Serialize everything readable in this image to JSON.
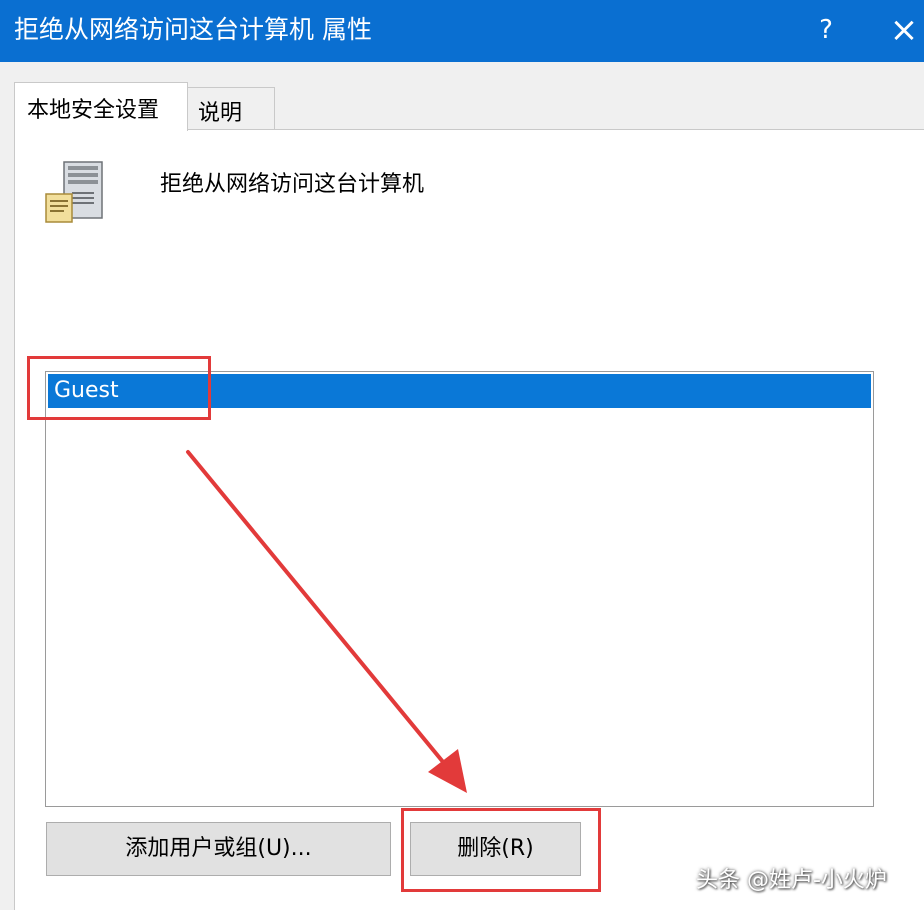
{
  "window": {
    "title": "拒绝从网络访问这台计算机 属性",
    "help_label": "?",
    "close_label": "×"
  },
  "tabs": [
    {
      "label": "本地安全设置",
      "active": true
    },
    {
      "label": "说明",
      "active": false
    }
  ],
  "policy": {
    "icon": "server-computer-icon",
    "name": "拒绝从网络访问这台计算机"
  },
  "user_list": {
    "items": [
      {
        "label": "Guest",
        "selected": true
      }
    ]
  },
  "buttons": {
    "add_label": "添加用户或组(U)...",
    "remove_label": "删除(R)"
  },
  "annotations": {
    "highlight_color": "#e23a3a",
    "watermark": "头条 @姓卢-小火炉"
  },
  "colors": {
    "titlebar": "#0a6fd1",
    "selection": "#0a78d7"
  }
}
